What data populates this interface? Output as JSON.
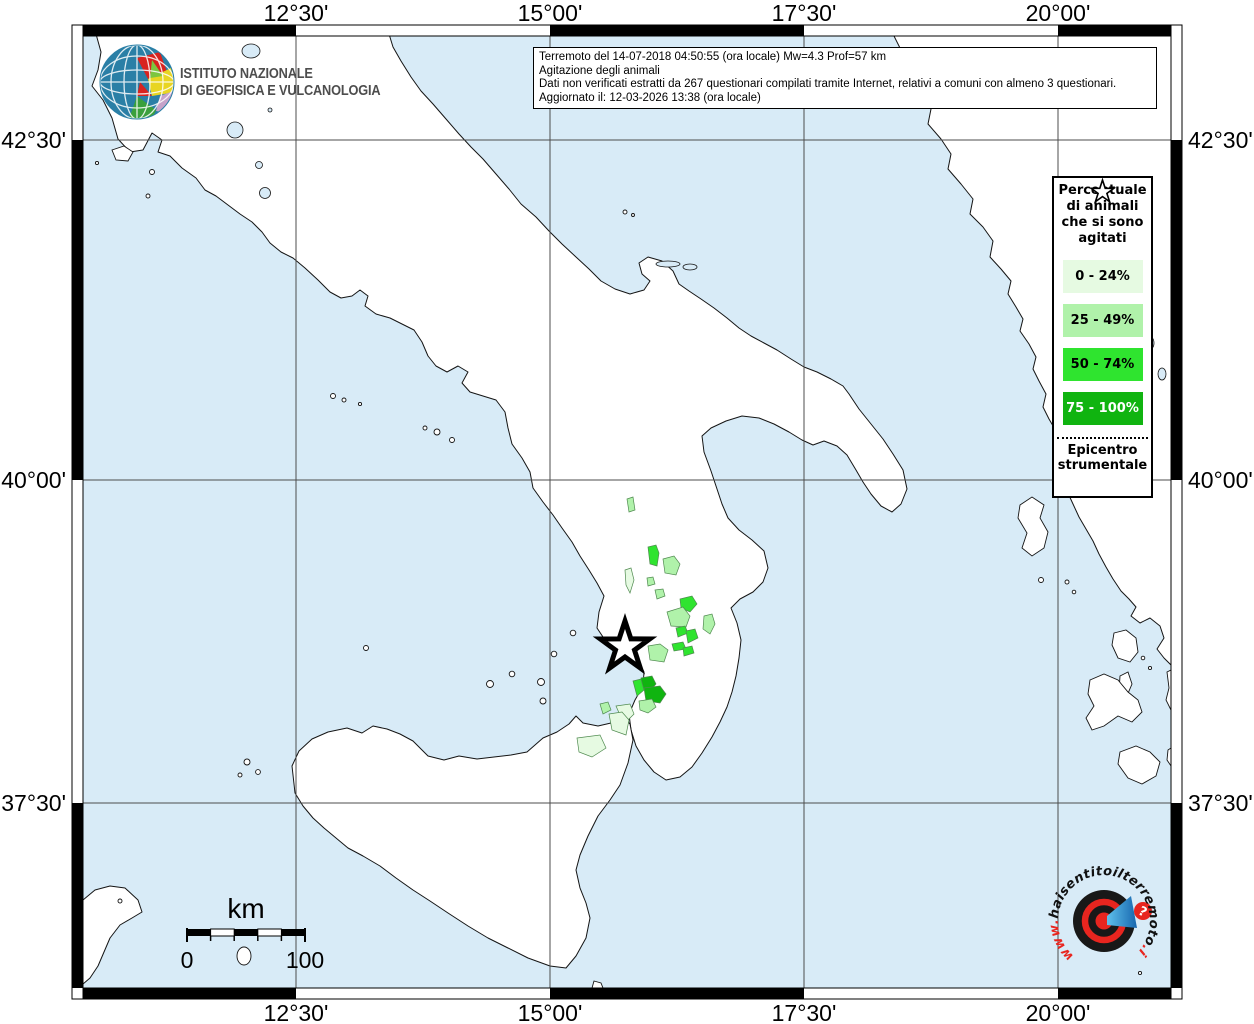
{
  "branding": {
    "ingv_line1": "ISTITUTO NAZIONALE",
    "ingv_line2": "DI GEOFISICA E VULCANOLOGIA"
  },
  "info_box": {
    "line1": "Terremoto del 14-07-2018 04:50:55 (ora locale) Mw=4.3 Prof=57 km",
    "line2": "Agitazione degli animali",
    "line3": "Dati non verificati estratti da 267 questionari compilati tramite Internet, relativi a comuni con almeno 3 questionari.",
    "line4": "Aggiornato il: 12-03-2026 13:38 (ora locale)"
  },
  "legend": {
    "title": "Percentuale di animali che si sono agitati",
    "items": [
      {
        "label": "0 - 24%",
        "color": "#e6fae2",
        "text_color": "#000000"
      },
      {
        "label": "25 - 49%",
        "color": "#b0f2aa",
        "text_color": "#000000"
      },
      {
        "label": "50 - 74%",
        "color": "#2fe42f",
        "text_color": "#000000"
      },
      {
        "label": "75 - 100%",
        "color": "#10b410",
        "text_color": "#ffffff"
      }
    ],
    "epicenter_label": "Epicentro strumentale"
  },
  "axes": {
    "top": [
      "12°30'",
      "15°00'",
      "17°30'",
      "20°00'"
    ],
    "bottom": [
      "12°30'",
      "15°00'",
      "17°30'",
      "20°00'"
    ],
    "left": [
      "42°30'",
      "40°00'",
      "37°30'"
    ],
    "right": [
      "42°30'",
      "40°00'",
      "37°30'"
    ]
  },
  "scalebar": {
    "unit": "km",
    "start": "0",
    "end": "100"
  },
  "watermark": {
    "www": "www.",
    "main": "haisentitoilterremoto",
    "it": ".it",
    "question": "?"
  },
  "map": {
    "sea_color": "#d8ebf7",
    "land_color": "#ffffff",
    "accent_red": "#e8251f",
    "accent_blue": "#2b8fd0"
  }
}
